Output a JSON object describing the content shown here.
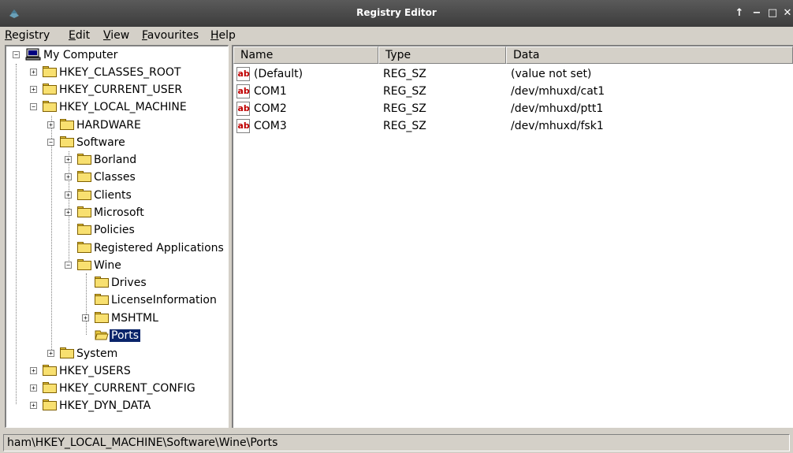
{
  "window": {
    "title": "Registry Editor",
    "controls": {
      "up": "↑",
      "minimize": "−",
      "maximize": "□",
      "close": "✕"
    }
  },
  "menu": {
    "items": [
      {
        "label": "Registry",
        "accel": "R",
        "rest": "egistry"
      },
      {
        "label": "Edit",
        "accel": "E",
        "rest": "dit"
      },
      {
        "label": "View",
        "accel": "V",
        "rest": "iew"
      },
      {
        "label": "Favourites",
        "accel": "F",
        "rest": "avourites"
      },
      {
        "label": "Help",
        "accel": "H",
        "rest": "elp"
      }
    ]
  },
  "tree": {
    "nodes": [
      {
        "label": "My Computer",
        "expander": "−"
      },
      {
        "label": "HKEY_CLASSES_ROOT",
        "expander": "+"
      },
      {
        "label": "HKEY_CURRENT_USER",
        "expander": "+"
      },
      {
        "label": "HKEY_LOCAL_MACHINE",
        "expander": "−"
      },
      {
        "label": "HARDWARE",
        "expander": "+"
      },
      {
        "label": "Software",
        "expander": "−"
      },
      {
        "label": "Borland",
        "expander": "+"
      },
      {
        "label": "Classes",
        "expander": "+"
      },
      {
        "label": "Clients",
        "expander": "+"
      },
      {
        "label": "Microsoft",
        "expander": "+"
      },
      {
        "label": "Policies",
        "expander": ""
      },
      {
        "label": "Registered Applications",
        "expander": ""
      },
      {
        "label": "Wine",
        "expander": "−"
      },
      {
        "label": "Drives",
        "expander": ""
      },
      {
        "label": "LicenseInformation",
        "expander": ""
      },
      {
        "label": "MSHTML",
        "expander": "+"
      },
      {
        "label": "Ports",
        "expander": "",
        "selected": true
      },
      {
        "label": "System",
        "expander": "+"
      },
      {
        "label": "HKEY_USERS",
        "expander": "+"
      },
      {
        "label": "HKEY_CURRENT_CONFIG",
        "expander": "+"
      },
      {
        "label": "HKEY_DYN_DATA",
        "expander": "+"
      }
    ]
  },
  "list": {
    "columns": [
      "Name",
      "Type",
      "Data"
    ],
    "rows": [
      {
        "name": "(Default)",
        "type": "REG_SZ",
        "data": "(value not set)",
        "icon": "ab"
      },
      {
        "name": "COM1",
        "type": "REG_SZ",
        "data": "/dev/mhuxd/cat1",
        "icon": "ab"
      },
      {
        "name": "COM2",
        "type": "REG_SZ",
        "data": "/dev/mhuxd/ptt1",
        "icon": "ab"
      },
      {
        "name": "COM3",
        "type": "REG_SZ",
        "data": "/dev/mhuxd/fsk1",
        "icon": "ab"
      }
    ]
  },
  "status": {
    "path": "ham\\HKEY_LOCAL_MACHINE\\Software\\Wine\\Ports"
  },
  "colors": {
    "selection": "#0a246a",
    "folder": "#f8e070",
    "chrome": "#d4d0c8"
  }
}
